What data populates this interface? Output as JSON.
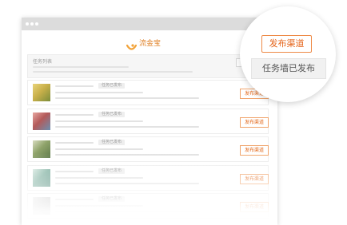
{
  "app": {
    "logo_text": "流金宝",
    "brand_color": "#e0832a"
  },
  "search_panel": {
    "title": "任务列表",
    "search_label": "搜索任务"
  },
  "tasks": [
    {
      "tag": "任务已发布",
      "button": "发布渠道",
      "thumb_colors": [
        "#c9b04a",
        "#e9d47a",
        "#7b8c3a"
      ]
    },
    {
      "tag": "任务已发布",
      "button": "发布渠道",
      "thumb_colors": [
        "#b35a5a",
        "#e8a7a0",
        "#6b8fb0"
      ]
    },
    {
      "tag": "任务已发布",
      "button": "发布渠道",
      "thumb_colors": [
        "#8fa36a",
        "#d8dcc0",
        "#5f7a4a"
      ]
    },
    {
      "tag": "任务已发布",
      "button": "发布渠道",
      "thumb_colors": [
        "#7fb0a0",
        "#d6e8e0",
        "#4f8a7a"
      ]
    },
    {
      "tag": "任务已发布",
      "button": "发布渠道",
      "thumb_colors": [
        "#c0c0c0",
        "#e6e6e6",
        "#9a9a9a"
      ]
    }
  ],
  "magnifier": {
    "button": "发布渠道",
    "status": "任务墙已发布"
  },
  "colors": {
    "accent": "#e5641a",
    "accent_border": "#ee8a47"
  }
}
